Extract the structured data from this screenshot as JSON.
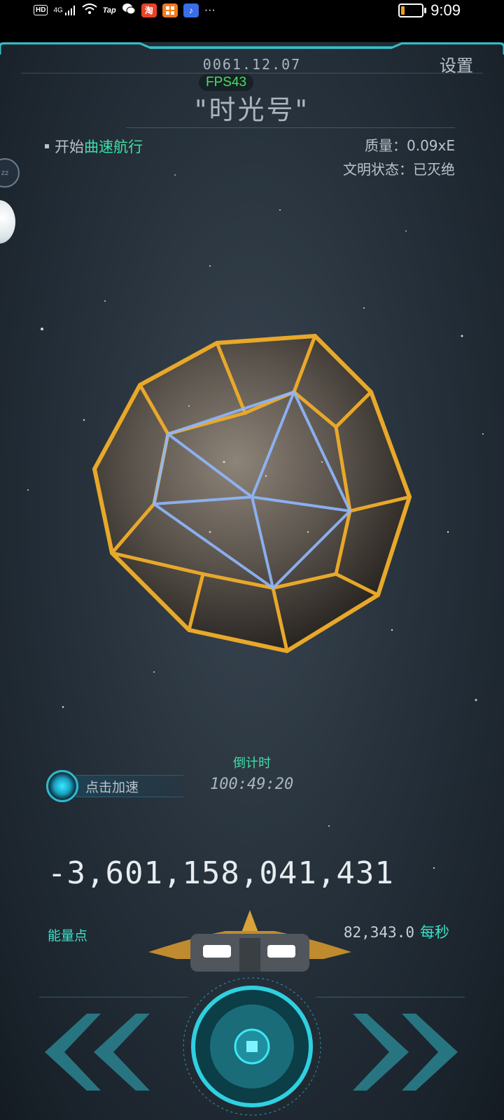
{
  "status_bar": {
    "badge_hd": "HD",
    "network": "4G",
    "tap": "Tap",
    "app1": "淘",
    "app2": "",
    "more": "···",
    "time": "9:09",
    "battery_level_percent": 10
  },
  "header": {
    "date": "0061.12.07",
    "fps": "FPS43",
    "settings_label": "设置",
    "ship_name": "\"时光号\""
  },
  "task": {
    "prefix": "开始",
    "highlight": "曲速航行"
  },
  "stats": {
    "mass": "质量：0.09xE",
    "civilization_status": "文明状态：已灭绝"
  },
  "side": {
    "sleep_icon_text": "zz"
  },
  "countdown": {
    "label": "倒计时",
    "value": "100:49:20"
  },
  "accelerate": {
    "label": "点击加速"
  },
  "energy": {
    "value": "-3,601,158,041,431",
    "label": "能量点",
    "rate_value": "82,343.0",
    "rate_unit": "每秒"
  },
  "colors": {
    "accent_teal": "#3de0c8",
    "accent_green": "#3de0a8",
    "fps_green": "#45e05a",
    "planet_gold": "#e8a82a",
    "frame_teal": "#2fb9d0"
  },
  "icons": {
    "accelerate": "accelerate-orb-icon",
    "nav_left": "double-chevron-left-icon",
    "nav_right": "double-chevron-right-icon",
    "center": "warp-core-button-icon"
  }
}
